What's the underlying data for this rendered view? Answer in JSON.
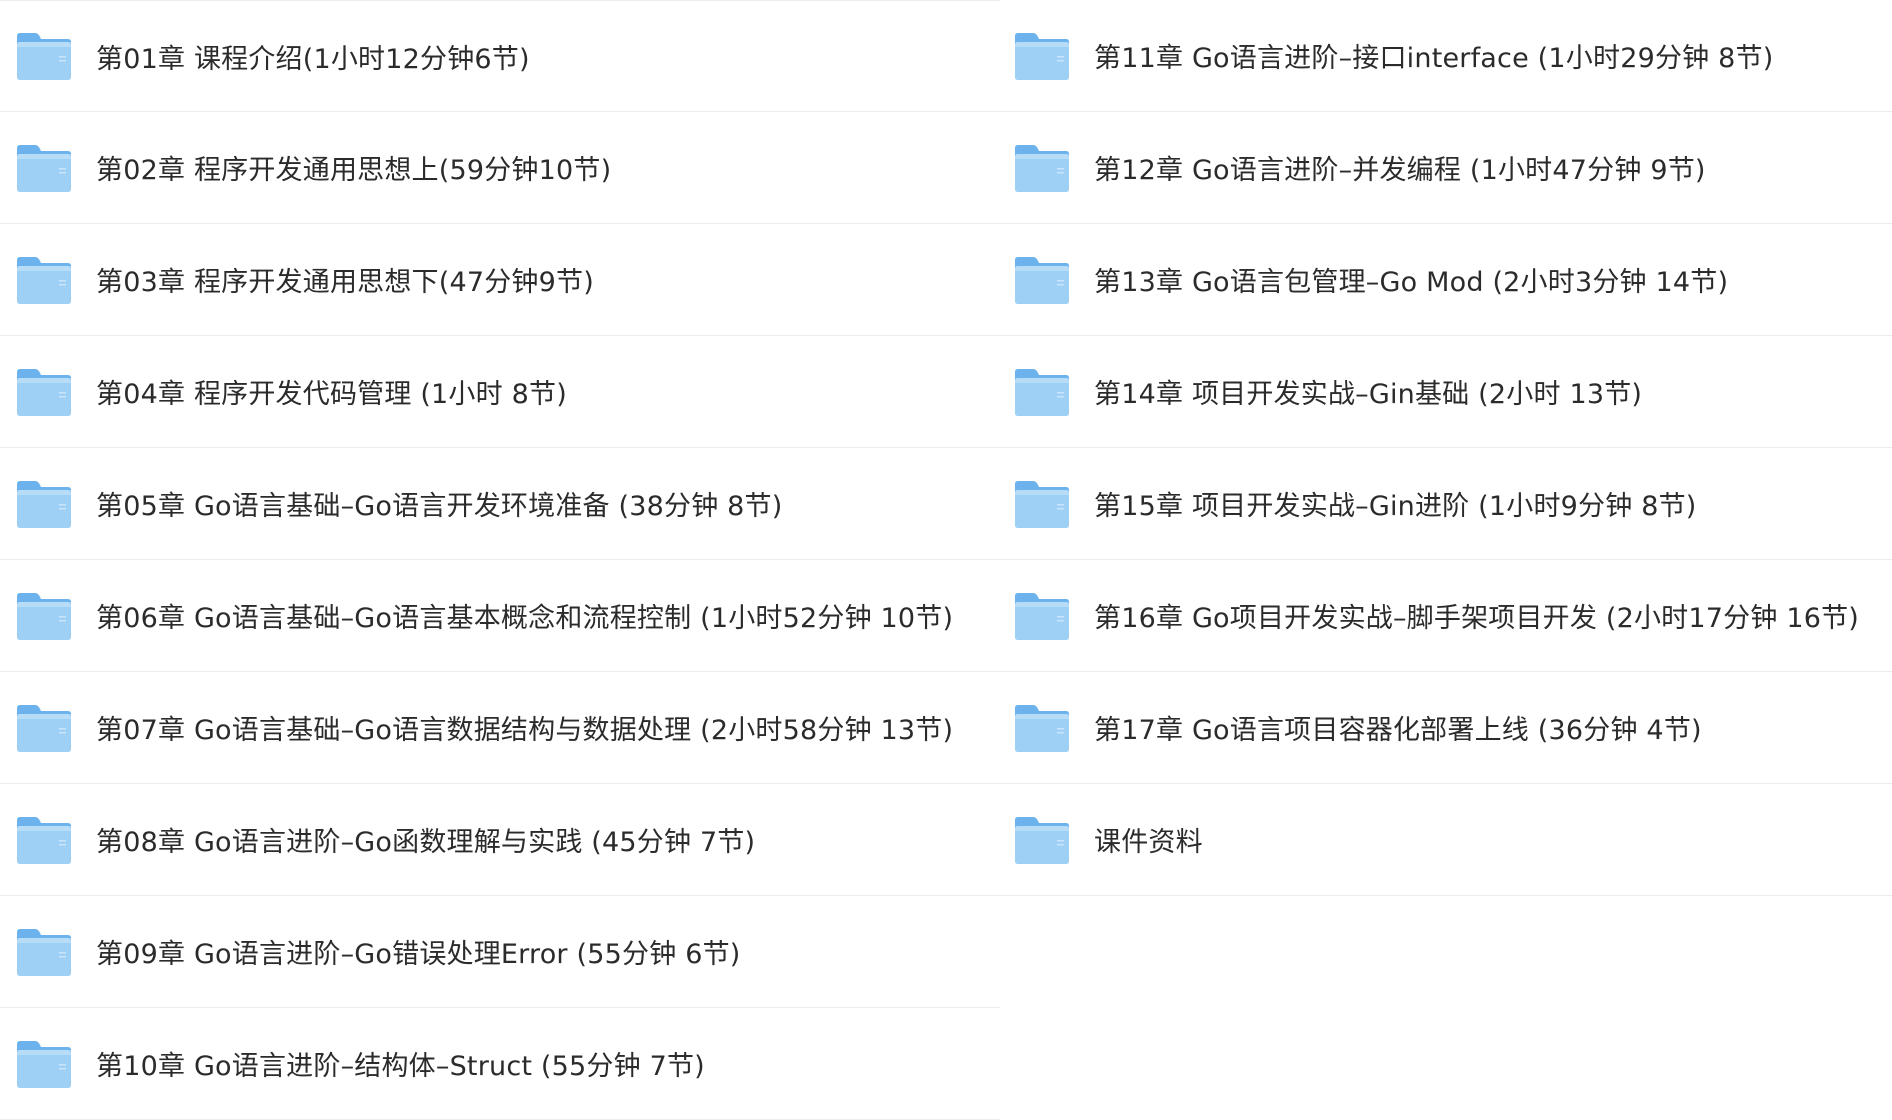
{
  "colors": {
    "folder_body": "#9ed0f5",
    "folder_back": "#6cb2ec",
    "text": "#2b2b2b",
    "divider": "#ececec"
  },
  "left_items": [
    {
      "label": "第01章 课程介绍(1小时12分钟6节)",
      "icon": "folder-icon"
    },
    {
      "label": "第02章 程序开发通用思想上(59分钟10节)",
      "icon": "folder-icon"
    },
    {
      "label": "第03章 程序开发通用思想下(47分钟9节)",
      "icon": "folder-icon"
    },
    {
      "label": "第04章 程序开发代码管理 (1小时 8节)",
      "icon": "folder-icon"
    },
    {
      "label": "第05章 Go语言基础–Go语言开发环境准备 (38分钟 8节)",
      "icon": "folder-icon"
    },
    {
      "label": "第06章 Go语言基础–Go语言基本概念和流程控制 (1小时52分钟 10节)",
      "icon": "folder-icon"
    },
    {
      "label": "第07章 Go语言基础–Go语言数据结构与数据处理 (2小时58分钟 13节)",
      "icon": "folder-icon"
    },
    {
      "label": "第08章 Go语言进阶–Go函数理解与实践 (45分钟 7节)",
      "icon": "folder-icon"
    },
    {
      "label": "第09章 Go语言进阶–Go错误处理Error (55分钟 6节)",
      "icon": "folder-icon"
    },
    {
      "label": "第10章 Go语言进阶–结构体–Struct (55分钟 7节)",
      "icon": "folder-icon"
    }
  ],
  "right_items": [
    {
      "label": "第11章 Go语言进阶–接口interface (1小时29分钟 8节)",
      "icon": "folder-icon"
    },
    {
      "label": "第12章 Go语言进阶–并发编程 (1小时47分钟 9节)",
      "icon": "folder-icon"
    },
    {
      "label": "第13章 Go语言包管理–Go Mod (2小时3分钟 14节)",
      "icon": "folder-icon"
    },
    {
      "label": "第14章 项目开发实战–Gin基础 (2小时 13节)",
      "icon": "folder-icon"
    },
    {
      "label": "第15章 项目开发实战–Gin进阶 (1小时9分钟 8节)",
      "icon": "folder-icon"
    },
    {
      "label": "第16章 Go项目开发实战–脚手架项目开发 (2小时17分钟 16节)",
      "icon": "folder-icon"
    },
    {
      "label": "第17章 Go语言项目容器化部署上线 (36分钟 4节)",
      "icon": "folder-icon"
    },
    {
      "label": "课件资料",
      "icon": "folder-icon"
    }
  ]
}
